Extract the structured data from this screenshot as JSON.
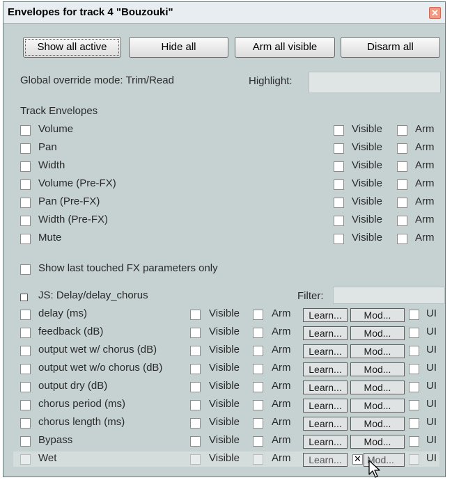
{
  "window": {
    "title": "Envelopes for track 4 \"Bouzouki\"",
    "close_glyph": "✕"
  },
  "toolbar": {
    "show_all_active": "Show all active",
    "hide_all": "Hide all",
    "arm_all_visible": "Arm all visible",
    "disarm_all": "Disarm all"
  },
  "global_override": "Global override mode: Trim/Read",
  "highlight_label": "Highlight:",
  "highlight_value": "",
  "track_envelopes": {
    "heading": "Track Envelopes",
    "visible_label": "Visible",
    "arm_label": "Arm",
    "items": [
      {
        "label": "Volume"
      },
      {
        "label": "Pan"
      },
      {
        "label": "Width"
      },
      {
        "label": "Volume (Pre-FX)"
      },
      {
        "label": "Pan (Pre-FX)"
      },
      {
        "label": "Width (Pre-FX)"
      },
      {
        "label": "Mute"
      }
    ]
  },
  "show_last_touched": "Show last touched FX parameters only",
  "plugin": {
    "collapse_glyph": "⊟",
    "name": "JS: Delay/delay_chorus",
    "filter_label": "Filter:",
    "filter_value": "",
    "visible_label": "Visible",
    "arm_label": "Arm",
    "learn_label": "Learn...",
    "mod_label": "Mod...",
    "ui_label": "UI",
    "params": [
      {
        "label": "delay (ms)",
        "mod_checked": false
      },
      {
        "label": "feedback (dB)",
        "mod_checked": false
      },
      {
        "label": "output wet w/ chorus (dB)",
        "mod_checked": false
      },
      {
        "label": "output wet w/o chorus (dB)",
        "mod_checked": false
      },
      {
        "label": "output dry (dB)",
        "mod_checked": false
      },
      {
        "label": "chorus period (ms)",
        "mod_checked": false
      },
      {
        "label": "chorus length (ms)",
        "mod_checked": false
      },
      {
        "label": "Bypass",
        "mod_checked": false
      },
      {
        "label": "Wet",
        "mod_checked": true,
        "highlighted": true
      }
    ]
  },
  "colors": {
    "window_bg": "#c6d2d2",
    "title_bg": "#e8edf2",
    "close_bg": "#f09a86"
  }
}
